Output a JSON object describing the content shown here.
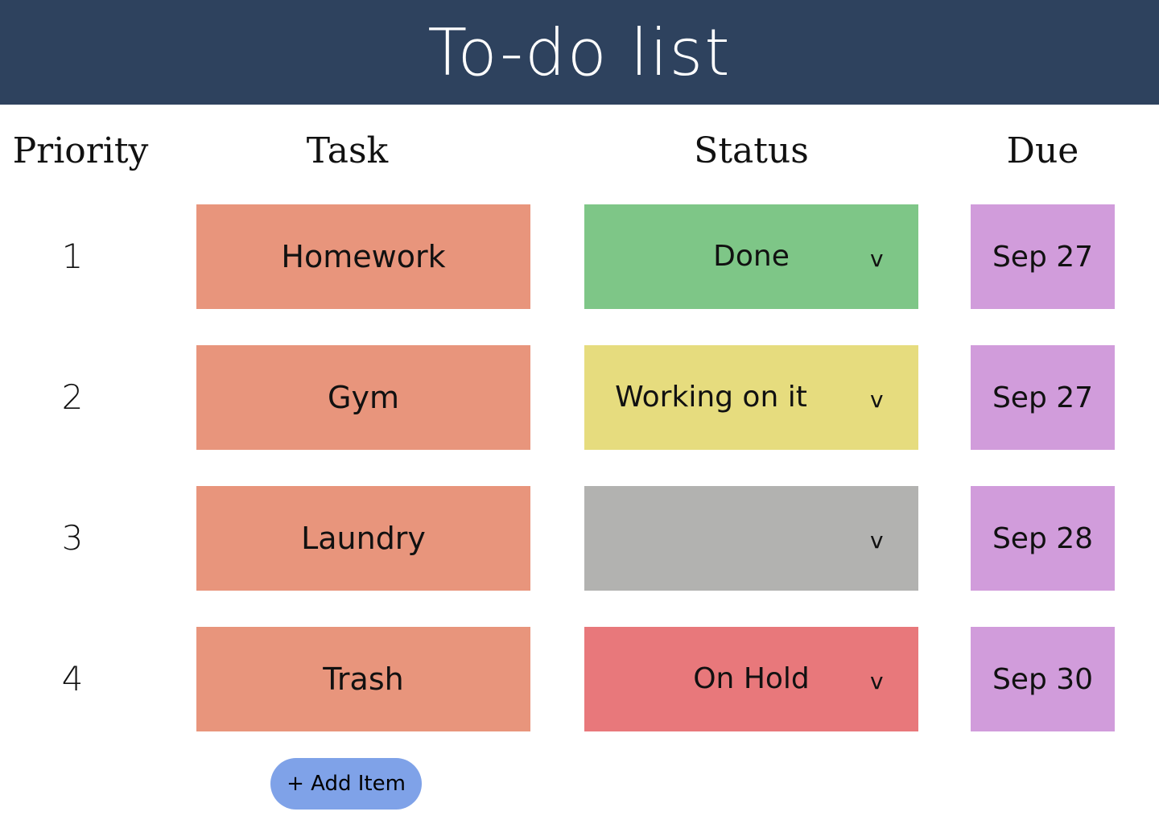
{
  "header": {
    "title": "To-do list"
  },
  "columns": {
    "priority": "Priority",
    "task": "Task",
    "status": "Status",
    "due": "Due"
  },
  "colors": {
    "header_bg": "#2e425e",
    "task_bg": "#e8957c",
    "due_bg": "#d19cdb",
    "add_button_bg": "#7fa2e8",
    "status_done": "#7ec687",
    "status_working": "#e6dc7e",
    "status_empty": "#b2b2b0",
    "status_on_hold": "#e8787b"
  },
  "status_chevron_icon": "chevron-down-icon",
  "status_chevron_glyph": "v",
  "rows": [
    {
      "priority": "1",
      "task": "Homework",
      "status": "Done",
      "status_color": "#7ec687",
      "due": "Sep 27"
    },
    {
      "priority": "2",
      "task": "Gym",
      "status": "Working on it",
      "status_color": "#e6dc7e",
      "due": "Sep 27"
    },
    {
      "priority": "3",
      "task": "Laundry",
      "status": "",
      "status_color": "#b2b2b0",
      "due": "Sep 28"
    },
    {
      "priority": "4",
      "task": "Trash",
      "status": "On Hold",
      "status_color": "#e8787b",
      "due": "Sep 30"
    }
  ],
  "add_button": {
    "label": "+ Add Item"
  }
}
